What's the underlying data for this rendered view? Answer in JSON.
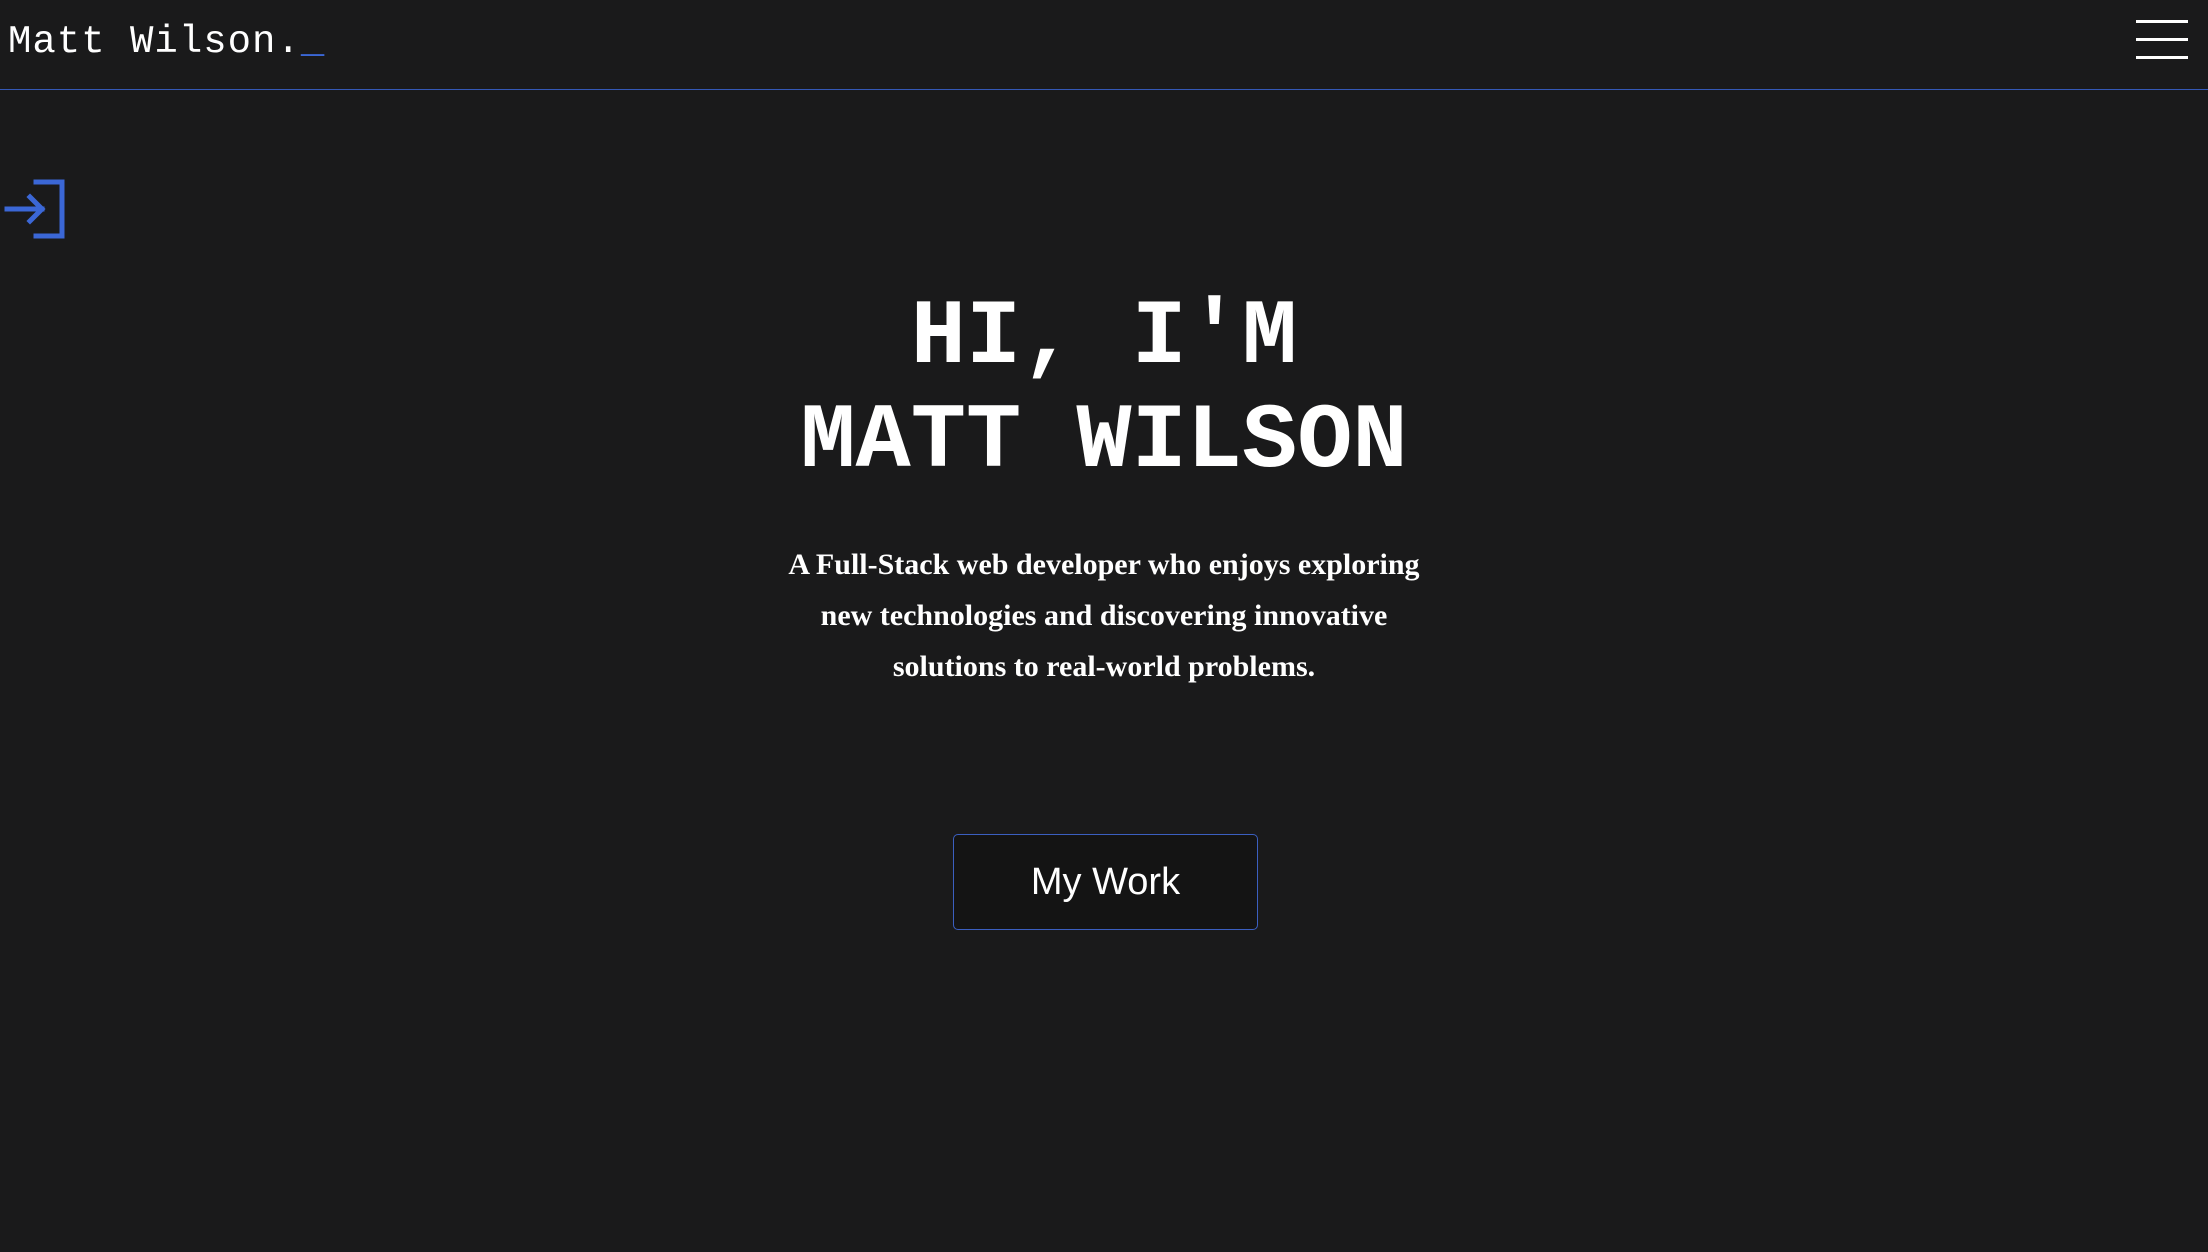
{
  "header": {
    "brand_name": "Matt Wilson.",
    "brand_cursor": "_",
    "menu_icon": "hamburger-menu-icon"
  },
  "sidebar": {
    "login_icon": "login-arrow-icon"
  },
  "hero": {
    "title_line1": "HI, I'M",
    "title_line2": "MATT WILSON",
    "description": "A Full-Stack web developer who enjoys exploring new technologies and discovering innovative solutions to real-world problems.",
    "cta_label": "My Work"
  },
  "colors": {
    "background": "#1a1a1b",
    "accent": "#3b67d6",
    "text": "#ffffff"
  }
}
